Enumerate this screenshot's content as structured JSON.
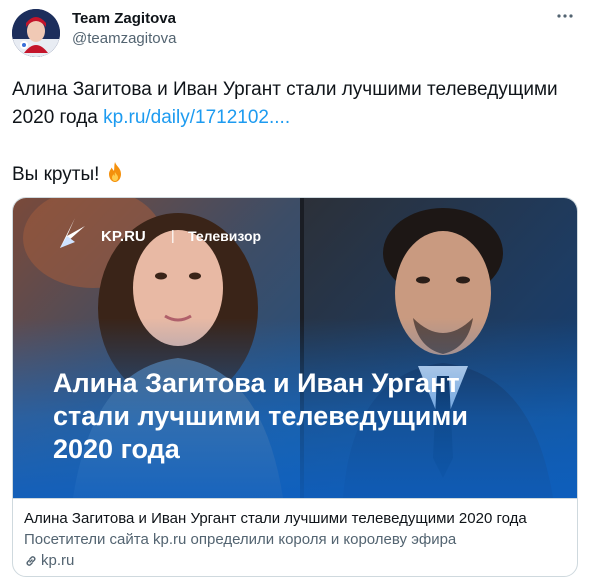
{
  "author": {
    "display_name": "Team Zagitova",
    "handle": "@teamzagitova"
  },
  "tweet": {
    "text_line1": "Алина Загитова и Иван Ургант стали лучшими телеведущими 2020 года ",
    "link_text": "kp.ru/daily/1712102....",
    "text_line2": "Вы круты!",
    "emoji": "fire-icon"
  },
  "card": {
    "image": {
      "brand": "KP.RU",
      "divider": "|",
      "section": "Телевизор",
      "headline_line1": "Алина Загитова и Иван Ургант",
      "headline_line2": "стали лучшими телеведущими",
      "headline_line3": "2020 года"
    },
    "title": "Алина Загитова и Иван Ургант стали лучшими телеведущими 2020 года",
    "description": "Посетители сайта kp.ru определили короля и королеву эфира",
    "domain": "kp.ru"
  },
  "colors": {
    "link": "#1d9bf0",
    "secondary_text": "#536471",
    "border": "#cfd9de"
  }
}
